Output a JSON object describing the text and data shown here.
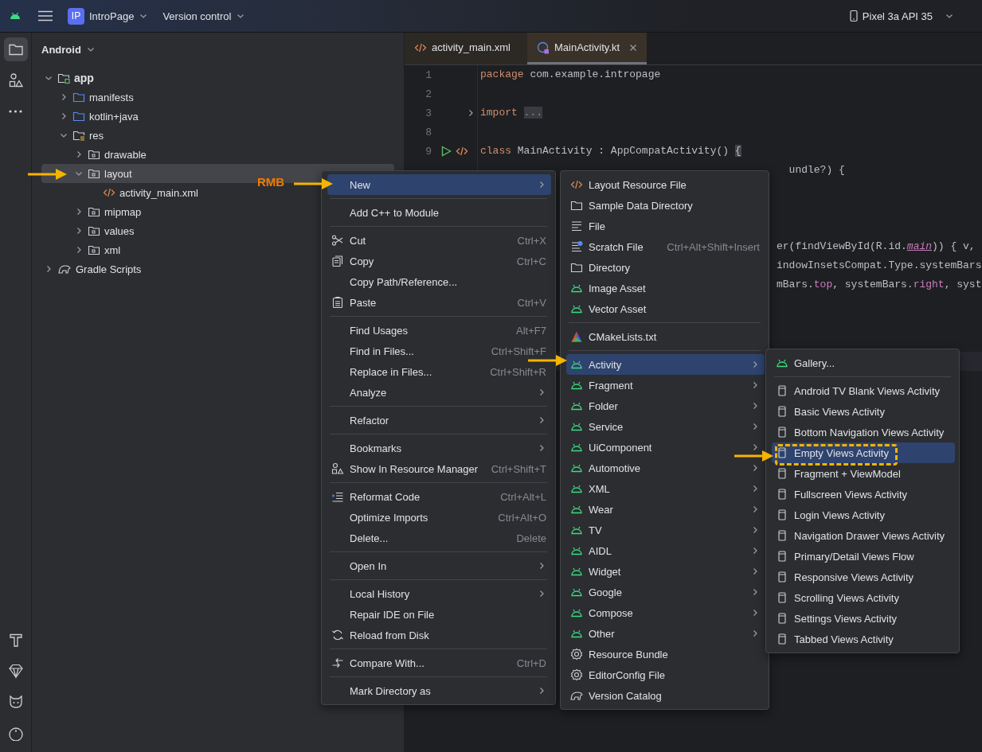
{
  "top_bar": {
    "project_badge": "IP",
    "project": "IntroPage",
    "vcs": "Version control",
    "device": "Pixel 3a API 35"
  },
  "tool_strip": [
    {
      "kind": "folder",
      "selected": true
    },
    {
      "kind": "shapes",
      "selected": false
    },
    {
      "kind": "more",
      "selected": false
    }
  ],
  "tool_strip_bottom": [
    {
      "kind": "hammer"
    },
    {
      "kind": "gem"
    },
    {
      "kind": "cat"
    },
    {
      "kind": "info"
    }
  ],
  "project_panel": {
    "view": "Android",
    "tree": [
      {
        "label": "app",
        "kind": "module",
        "expanded": true,
        "selected": false,
        "children": [
          {
            "label": "manifests",
            "kind": "source",
            "expanded": false,
            "selected": false
          },
          {
            "label": "kotlin+java",
            "kind": "source",
            "expanded": false,
            "selected": false
          },
          {
            "label": "res",
            "kind": "res",
            "expanded": true,
            "selected": false,
            "children": [
              {
                "label": "drawable",
                "kind": "package",
                "expanded": false,
                "selected": false
              },
              {
                "label": "layout",
                "kind": "package",
                "expanded": true,
                "selected": true,
                "children": [
                  {
                    "label": "activity_main.xml",
                    "kind": "xml",
                    "selected": false
                  }
                ]
              },
              {
                "label": "mipmap",
                "kind": "package",
                "expanded": false,
                "selected": false
              },
              {
                "label": "values",
                "kind": "package",
                "expanded": false,
                "selected": false
              },
              {
                "label": "xml",
                "kind": "package",
                "expanded": false,
                "selected": false
              }
            ]
          }
        ]
      },
      {
        "label": "Gradle Scripts",
        "kind": "gradle",
        "expanded": false,
        "selected": false
      }
    ]
  },
  "editor": {
    "tabs": [
      {
        "label": "activity_main.xml",
        "kind": "xml",
        "selected": false
      },
      {
        "label": "MainActivity.kt",
        "kind": "kotlin",
        "selected": true,
        "closable": true
      }
    ],
    "rows": [
      {
        "kind": "line",
        "number": "1",
        "code": [
          {
            "text": "package ",
            "kind": "keyword"
          },
          {
            "text": "com.example.intropage",
            "kind": "plain"
          }
        ]
      },
      {
        "kind": "line",
        "number": "2"
      },
      {
        "kind": "line",
        "number": "3",
        "folded": true,
        "code": [
          {
            "text": "import ",
            "kind": "keyword"
          },
          {
            "text": "...",
            "kind": "fold"
          }
        ]
      },
      {
        "kind": "line",
        "number": "8"
      },
      {
        "kind": "line",
        "number": "9",
        "runnable": true,
        "code": [
          {
            "text": "class ",
            "kind": "keyword"
          },
          {
            "text": "MainActivity : AppCompatActivity() ",
            "kind": "plain"
          },
          {
            "text": "{",
            "kind": "brace"
          }
        ]
      },
      {
        "kind": "partial",
        "code": [
          {
            "text": "  undle?) {",
            "kind": "plain"
          }
        ]
      },
      {
        "kind": "covered"
      },
      {
        "kind": "covered"
      },
      {
        "kind": "covered"
      },
      {
        "kind": "partial",
        "code": [
          {
            "text": "er(findViewById(R.id.",
            "kind": "plain"
          },
          {
            "text": "main",
            "kind": "italic-field"
          },
          {
            "text": ")) { v, ",
            "kind": "plain"
          }
        ]
      },
      {
        "kind": "partial",
        "code": [
          {
            "text": "indowInsetsCompat.Type.systemBars",
            "kind": "plain"
          }
        ]
      },
      {
        "kind": "partial",
        "code": [
          {
            "text": "mBars.",
            "kind": "plain"
          },
          {
            "text": "top",
            "kind": "field"
          },
          {
            "text": ", systemBars.",
            "kind": "plain"
          },
          {
            "text": "right",
            "kind": "field"
          },
          {
            "text": ", syst",
            "kind": "plain"
          }
        ]
      },
      {
        "kind": "covered"
      },
      {
        "kind": "covered"
      },
      {
        "kind": "covered"
      },
      {
        "kind": "covered",
        "current": true
      }
    ]
  },
  "context_menu": {
    "items": [
      {
        "kind": "plain",
        "label": "New",
        "submenu": true,
        "selected": true
      },
      {
        "kind": "separator"
      },
      {
        "kind": "plain",
        "label": "Add C++ to Module",
        "selected": false
      },
      {
        "kind": "separator"
      },
      {
        "kind": "cut",
        "label": "Cut",
        "shortcut": "Ctrl+X",
        "selected": false
      },
      {
        "kind": "copy",
        "label": "Copy",
        "shortcut": "Ctrl+C",
        "selected": false
      },
      {
        "kind": "plain",
        "label": "Copy Path/Reference...",
        "selected": false
      },
      {
        "kind": "paste",
        "label": "Paste",
        "shortcut": "Ctrl+V",
        "selected": false
      },
      {
        "kind": "separator"
      },
      {
        "kind": "plain",
        "label": "Find Usages",
        "shortcut": "Alt+F7",
        "selected": false
      },
      {
        "kind": "plain",
        "label": "Find in Files...",
        "shortcut": "Ctrl+Shift+F",
        "selected": false
      },
      {
        "kind": "plain",
        "label": "Replace in Files...",
        "shortcut": "Ctrl+Shift+R",
        "selected": false
      },
      {
        "kind": "plain",
        "label": "Analyze",
        "submenu": true,
        "selected": false
      },
      {
        "kind": "separator"
      },
      {
        "kind": "plain",
        "label": "Refactor",
        "submenu": true,
        "selected": false
      },
      {
        "kind": "separator"
      },
      {
        "kind": "plain",
        "label": "Bookmarks",
        "submenu": true,
        "selected": false
      },
      {
        "kind": "resources",
        "label": "Show In Resource Manager",
        "shortcut": "Ctrl+Shift+T",
        "selected": false
      },
      {
        "kind": "separator"
      },
      {
        "kind": "reformat",
        "label": "Reformat Code",
        "shortcut": "Ctrl+Alt+L",
        "selected": false
      },
      {
        "kind": "plain",
        "label": "Optimize Imports",
        "shortcut": "Ctrl+Alt+O",
        "selected": false
      },
      {
        "kind": "plain",
        "label": "Delete...",
        "shortcut": "Delete",
        "selected": false
      },
      {
        "kind": "separator"
      },
      {
        "kind": "plain",
        "label": "Open In",
        "submenu": true,
        "selected": false
      },
      {
        "kind": "separator"
      },
      {
        "kind": "plain",
        "label": "Local History",
        "submenu": true,
        "selected": false
      },
      {
        "kind": "plain",
        "label": "Repair IDE on File",
        "selected": false
      },
      {
        "kind": "reload",
        "label": "Reload from Disk",
        "selected": false
      },
      {
        "kind": "separator"
      },
      {
        "kind": "compare",
        "label": "Compare With...",
        "shortcut": "Ctrl+D",
        "selected": false
      },
      {
        "kind": "separator"
      },
      {
        "kind": "plain",
        "label": "Mark Directory as",
        "submenu": true,
        "selected": false
      }
    ]
  },
  "new_submenu": {
    "items": [
      {
        "kind": "layout",
        "label": "Layout Resource File",
        "selected": false
      },
      {
        "kind": "folder",
        "label": "Sample Data Directory",
        "selected": false
      },
      {
        "kind": "file",
        "label": "File",
        "selected": false
      },
      {
        "kind": "scratch",
        "label": "Scratch File",
        "shortcut": "Ctrl+Alt+Shift+Insert",
        "selected": false
      },
      {
        "kind": "folder",
        "label": "Directory",
        "selected": false
      },
      {
        "kind": "android",
        "label": "Image Asset",
        "selected": false
      },
      {
        "kind": "android",
        "label": "Vector Asset",
        "selected": false
      },
      {
        "kind": "separator"
      },
      {
        "kind": "cmake",
        "label": "CMakeLists.txt",
        "selected": false
      },
      {
        "kind": "separator"
      },
      {
        "kind": "android",
        "label": "Activity",
        "submenu": true,
        "selected": true
      },
      {
        "kind": "android",
        "label": "Fragment",
        "submenu": true,
        "selected": false
      },
      {
        "kind": "android",
        "label": "Folder",
        "submenu": true,
        "selected": false
      },
      {
        "kind": "android",
        "label": "Service",
        "submenu": true,
        "selected": false
      },
      {
        "kind": "android",
        "label": "UiComponent",
        "submenu": true,
        "selected": false
      },
      {
        "kind": "android",
        "label": "Automotive",
        "submenu": true,
        "selected": false
      },
      {
        "kind": "android",
        "label": "XML",
        "submenu": true,
        "selected": false
      },
      {
        "kind": "android",
        "label": "Wear",
        "submenu": true,
        "selected": false
      },
      {
        "kind": "android",
        "label": "TV",
        "submenu": true,
        "selected": false
      },
      {
        "kind": "android",
        "label": "AIDL",
        "submenu": true,
        "selected": false
      },
      {
        "kind": "android",
        "label": "Widget",
        "submenu": true,
        "selected": false
      },
      {
        "kind": "android",
        "label": "Google",
        "submenu": true,
        "selected": false
      },
      {
        "kind": "android",
        "label": "Compose",
        "submenu": true,
        "selected": false
      },
      {
        "kind": "android",
        "label": "Other",
        "submenu": true,
        "selected": false
      },
      {
        "kind": "gear",
        "label": "Resource Bundle",
        "selected": false
      },
      {
        "kind": "gear",
        "label": "EditorConfig File",
        "selected": false
      },
      {
        "kind": "catalog",
        "label": "Version Catalog",
        "selected": false
      }
    ]
  },
  "activity_submenu": {
    "items": [
      {
        "kind": "android",
        "label": "Gallery...",
        "selected": false
      },
      {
        "kind": "separator"
      },
      {
        "kind": "template",
        "label": "Android TV Blank Views Activity",
        "selected": false
      },
      {
        "kind": "template",
        "label": "Basic Views Activity",
        "selected": false
      },
      {
        "kind": "template",
        "label": "Bottom Navigation Views Activity",
        "selected": false
      },
      {
        "kind": "template",
        "label": "Empty Views Activity",
        "selected": true,
        "marked": true
      },
      {
        "kind": "template",
        "label": "Fragment + ViewModel",
        "selected": false
      },
      {
        "kind": "template",
        "label": "Fullscreen Views Activity",
        "selected": false
      },
      {
        "kind": "template",
        "label": "Login Views Activity",
        "selected": false
      },
      {
        "kind": "template",
        "label": "Navigation Drawer Views Activity",
        "selected": false
      },
      {
        "kind": "template",
        "label": "Primary/Detail Views Flow",
        "selected": false
      },
      {
        "kind": "template",
        "label": "Responsive Views Activity",
        "selected": false
      },
      {
        "kind": "template",
        "label": "Scrolling Views Activity",
        "selected": false
      },
      {
        "kind": "template",
        "label": "Settings Views Activity",
        "selected": false
      },
      {
        "kind": "template",
        "label": "Tabbed Views Activity",
        "selected": false
      }
    ]
  },
  "annotation": {
    "label": "RMB"
  }
}
